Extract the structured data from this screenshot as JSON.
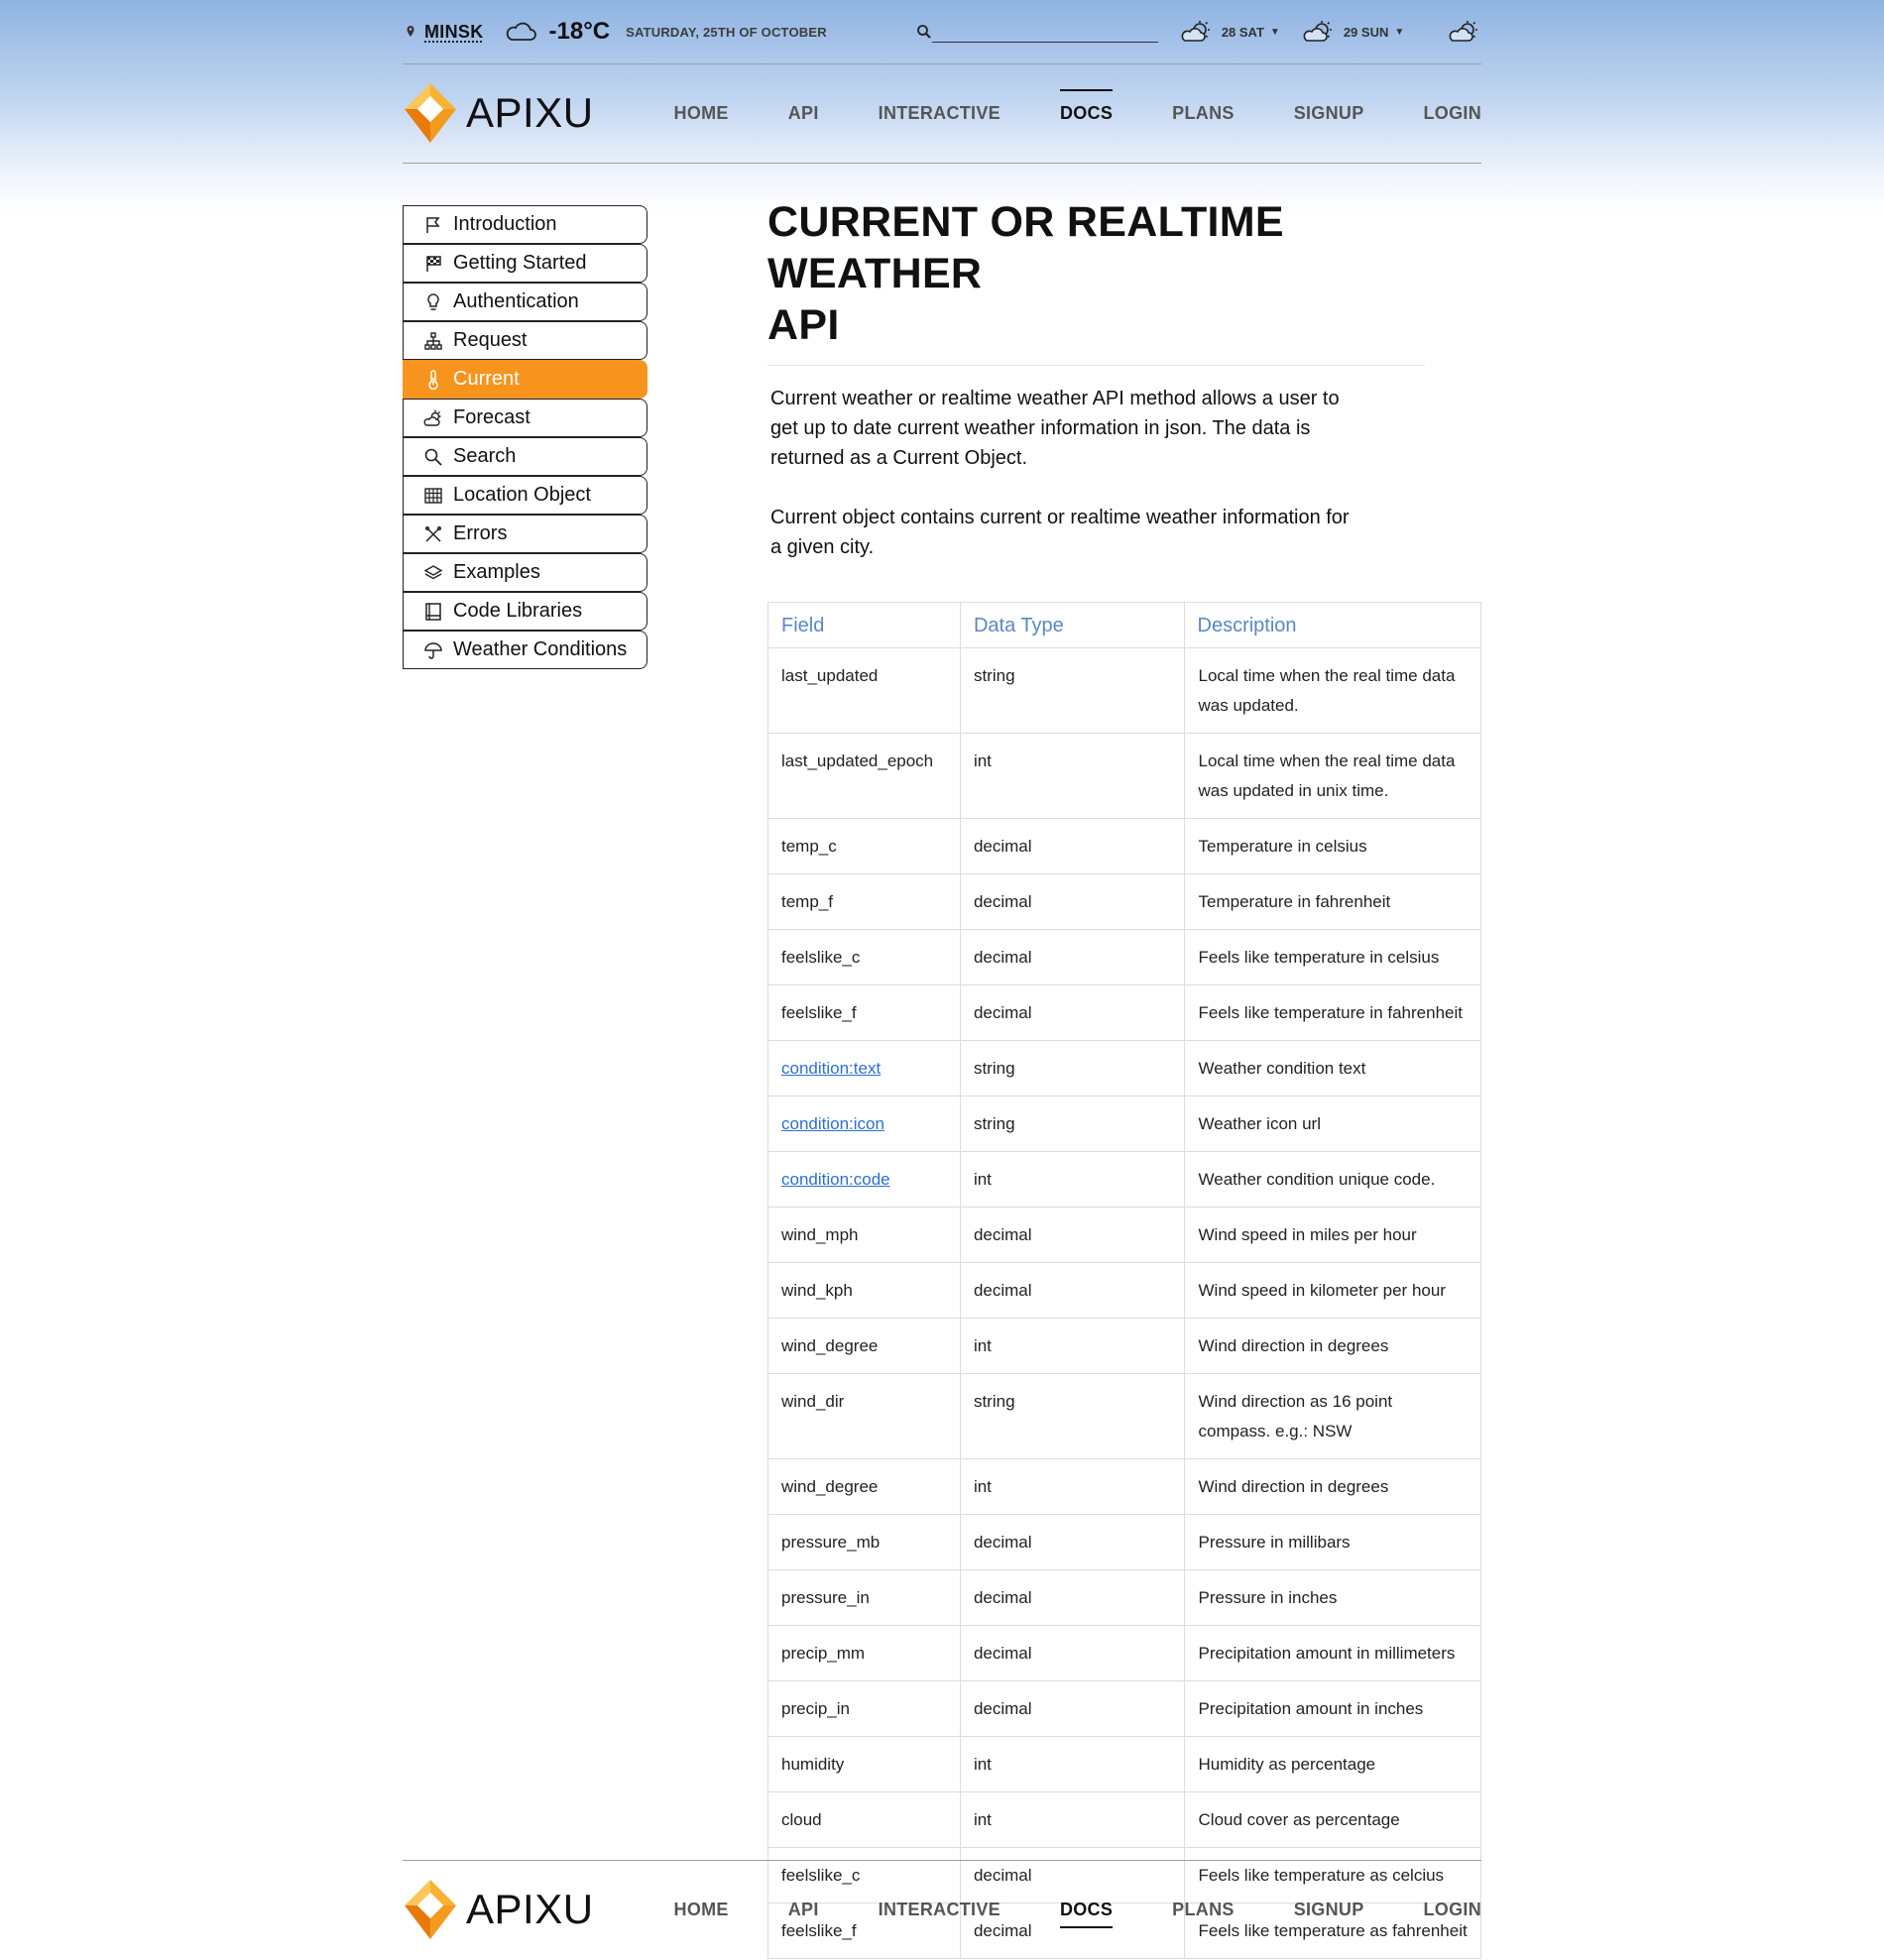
{
  "weather_bar": {
    "city": "MINSK",
    "temperature": "-18°C",
    "date": "SATURDAY, 25TH OF OCTOBER",
    "search_placeholder": "",
    "forecast": [
      {
        "label": "28 SAT",
        "icon": "sun-cloud-icon"
      },
      {
        "label": "29 SUN",
        "icon": "sun-cloud-icon"
      }
    ]
  },
  "brand": {
    "name": "APIXU",
    "colors": {
      "logo_yellow": "#f9b233",
      "logo_orange": "#e87a0c",
      "accent": "#f7941d"
    }
  },
  "nav": {
    "items": [
      "HOME",
      "API",
      "INTERACTIVE",
      "DOCS",
      "PLANS",
      "SIGNUP",
      "LOGIN"
    ],
    "active": "DOCS"
  },
  "sidebar": {
    "items": [
      {
        "label": "Introduction",
        "icon": "flag-icon"
      },
      {
        "label": "Getting Started",
        "icon": "checkered-flag-icon"
      },
      {
        "label": "Authentication",
        "icon": "lightbulb-icon"
      },
      {
        "label": "Request",
        "icon": "sitemap-icon"
      },
      {
        "label": "Current",
        "icon": "thermometer-icon",
        "active": true
      },
      {
        "label": "Forecast",
        "icon": "sun-cloud-icon"
      },
      {
        "label": "Search",
        "icon": "search-icon"
      },
      {
        "label": "Location Object",
        "icon": "grid-icon"
      },
      {
        "label": "Errors",
        "icon": "cross-icon"
      },
      {
        "label": "Examples",
        "icon": "layers-icon"
      },
      {
        "label": "Code Libraries",
        "icon": "book-icon"
      },
      {
        "label": "Weather Conditions",
        "icon": "umbrella-icon"
      }
    ]
  },
  "main": {
    "title_line1": "CURRENT OR REALTIME WEATHER",
    "title_line2": "API",
    "para1": "Current weather or realtime weather API method allows a user to get up to date current weather information in json. The data is returned as a Current Object.",
    "para2": "Current object contains current or realtime weather information for a given city.",
    "table": {
      "headers": [
        "Field",
        "Data Type",
        "Description"
      ],
      "rows": [
        {
          "field": "last_updated",
          "type": "string",
          "desc": "Local time when the real time data was updated.",
          "link": false
        },
        {
          "field": "last_updated_epoch",
          "type": "int",
          "desc": "Local time when the real time data was updated in unix time.",
          "link": false
        },
        {
          "field": "temp_c",
          "type": "decimal",
          "desc": "Temperature in celsius",
          "link": false
        },
        {
          "field": "temp_f",
          "type": "decimal",
          "desc": "Temperature in fahrenheit",
          "link": false
        },
        {
          "field": "feelslike_c",
          "type": "decimal",
          "desc": "Feels like temperature in celsius",
          "link": false
        },
        {
          "field": "feelslike_f",
          "type": "decimal",
          "desc": "Feels like temperature in fahrenheit",
          "link": false
        },
        {
          "field": "condition:text",
          "type": "string",
          "desc": "Weather condition text",
          "link": true
        },
        {
          "field": "condition:icon",
          "type": "string",
          "desc": "Weather icon url",
          "link": true
        },
        {
          "field": "condition:code",
          "type": "int",
          "desc": "Weather condition unique code.",
          "link": true
        },
        {
          "field": "wind_mph",
          "type": "decimal",
          "desc": "Wind speed in miles per hour",
          "link": false
        },
        {
          "field": "wind_kph",
          "type": "decimal",
          "desc": "Wind speed in kilometer per hour",
          "link": false
        },
        {
          "field": "wind_degree",
          "type": "int",
          "desc": "Wind direction in degrees",
          "link": false
        },
        {
          "field": "wind_dir",
          "type": "string",
          "desc": "Wind direction as 16 point compass. e.g.: NSW",
          "link": false
        },
        {
          "field": "wind_degree",
          "type": "int",
          "desc": "Wind direction in degrees",
          "link": false
        },
        {
          "field": "pressure_mb",
          "type": "decimal",
          "desc": "Pressure in millibars",
          "link": false
        },
        {
          "field": "pressure_in",
          "type": "decimal",
          "desc": "Pressure in inches",
          "link": false
        },
        {
          "field": "precip_mm",
          "type": "decimal",
          "desc": "Precipitation amount in millimeters",
          "link": false
        },
        {
          "field": "precip_in",
          "type": "decimal",
          "desc": "Precipitation amount in inches",
          "link": false
        },
        {
          "field": "humidity",
          "type": "int",
          "desc": "Humidity as percentage",
          "link": false
        },
        {
          "field": "cloud",
          "type": "int",
          "desc": "Cloud cover as percentage",
          "link": false
        },
        {
          "field": "feelslike_c",
          "type": "decimal",
          "desc": "Feels like temperature as celcius",
          "link": false
        },
        {
          "field": "feelslike_f",
          "type": "decimal",
          "desc": "Feels like temperature as fahrenheit",
          "link": false
        }
      ]
    }
  }
}
